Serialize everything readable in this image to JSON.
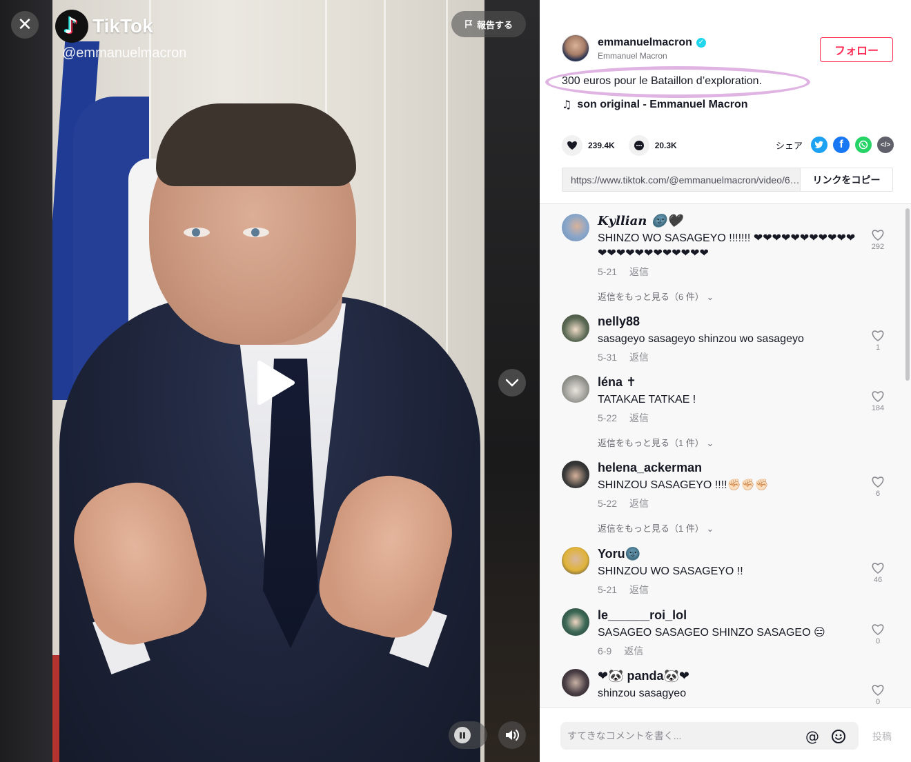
{
  "video": {
    "logo_text": "TikTok",
    "handle": "@emmanuelmacron",
    "report_label": "報告する"
  },
  "author": {
    "username": "emmanuelmacron",
    "nickname": "Emmanuel Macron",
    "follow_label": "フォロー"
  },
  "post": {
    "description": "300 euros pour le Bataillon d’exploration.",
    "music": "son original - Emmanuel Macron",
    "likes": "239.4K",
    "comments": "20.3K",
    "share_label": "シェア",
    "link": "https://www.tiktok.com/@emmanuelmacron/video/6966412712345678901",
    "copy_label": "リンクをコピー"
  },
  "comments": [
    {
      "name": "𝑲𝒚𝒍𝒍𝒊𝒂𝒏 🌚🖤",
      "text": "SHINZO WO SASAGEYO !!!!!!! ❤❤❤❤❤❤❤❤❤❤❤❤❤❤❤❤❤❤❤❤❤❤❤",
      "date": "5-21",
      "reply": "返信",
      "likes": "292",
      "more": "返信をもっと見る（6 件）"
    },
    {
      "name": "nelly88",
      "text": "sasageyo sasageyo shinzou wo sasageyo",
      "date": "5-31",
      "reply": "返信",
      "likes": "1"
    },
    {
      "name": "léna ✝",
      "text": "TATAKAE TATKAE !",
      "date": "5-22",
      "reply": "返信",
      "likes": "184",
      "more": "返信をもっと見る（1 件）"
    },
    {
      "name": "helena_ackerman",
      "text": "SHINZOU SASAGEYO !!!!✊🏻✊🏻✊🏻",
      "date": "5-22",
      "reply": "返信",
      "likes": "6",
      "more": "返信をもっと見る（1 件）"
    },
    {
      "name": "Yoru🌚",
      "text": "SHINZOU WO SASAGEYO !!",
      "date": "5-21",
      "reply": "返信",
      "likes": "46"
    },
    {
      "name": "le______roi_lol",
      "text": "SASAGEO SASAGEO SHINZO SASAGEO 😑",
      "date": "6-9",
      "reply": "返信",
      "likes": "0"
    },
    {
      "name": "❤🐼 panda🐼❤",
      "text": "shinzou sasagyeo",
      "date": "",
      "reply": "",
      "likes": "0"
    }
  ],
  "comment_input": {
    "placeholder": "すてきなコメントを書く...",
    "post_label": "投稿"
  },
  "colors": {
    "accent": "#fe2c55",
    "verified": "#20d5ec",
    "twitter": "#1da1f2",
    "facebook": "#1877f2",
    "whatsapp": "#25d366",
    "embed": "#5f6069"
  }
}
